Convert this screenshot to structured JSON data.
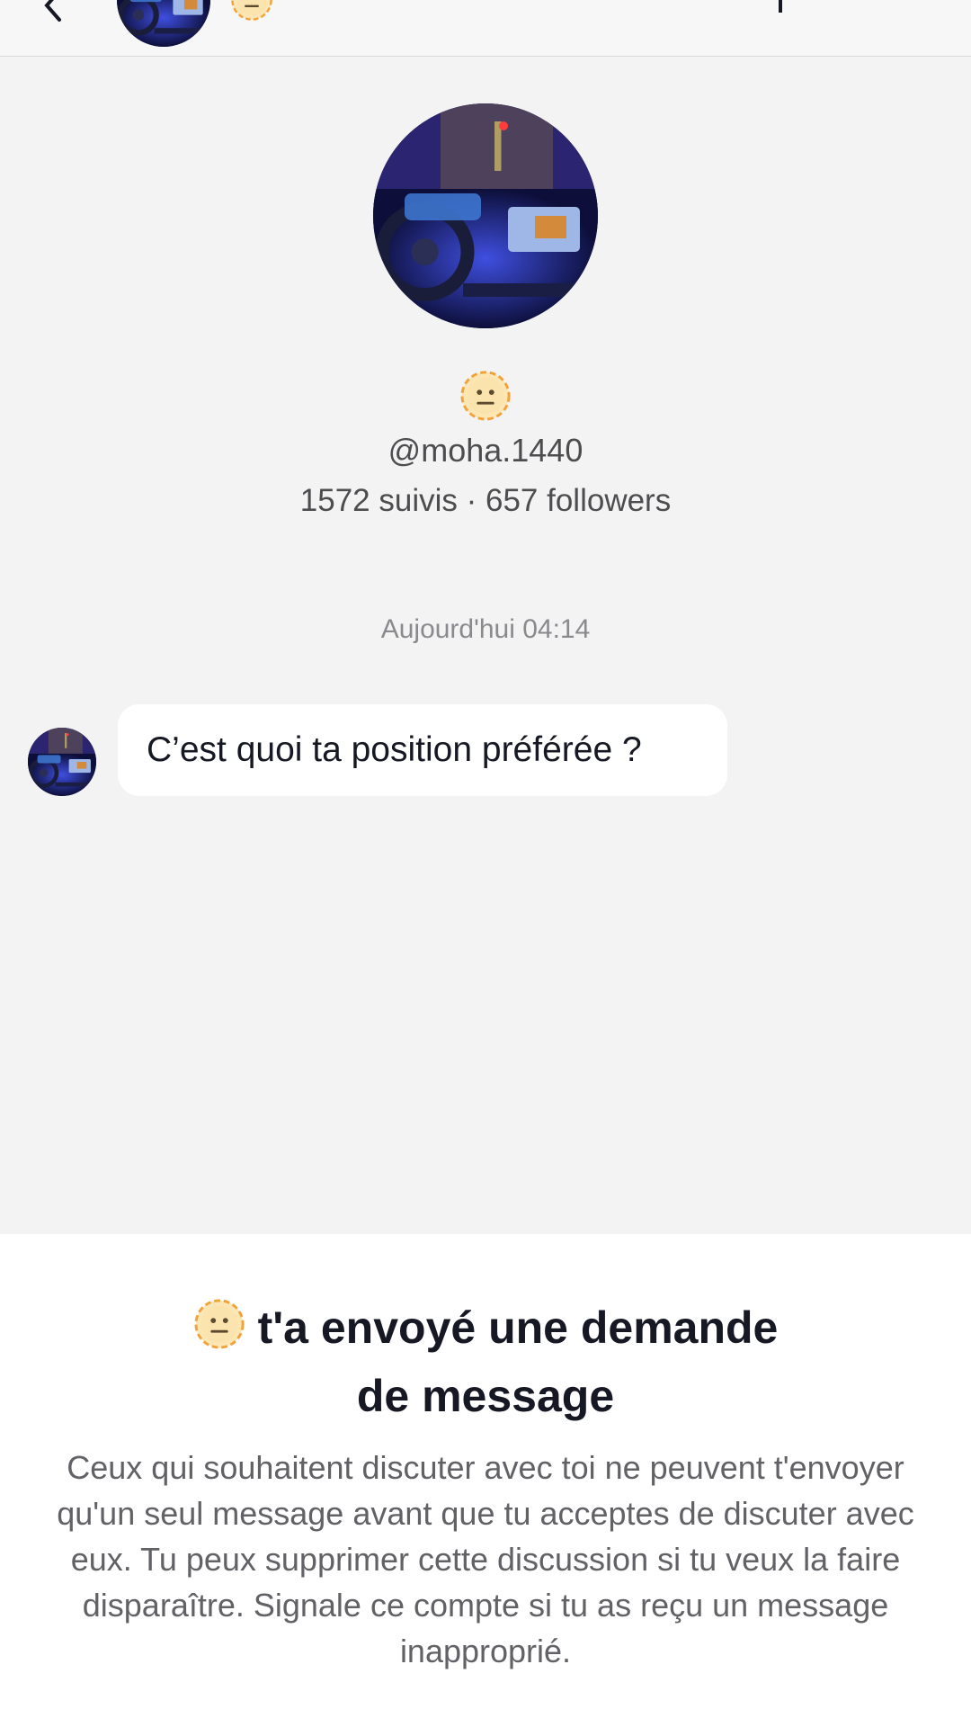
{
  "header": {
    "back_icon": "chevron-left-icon",
    "avatar_icon": "profile-photo",
    "status_icon": "neutral-face-emoji",
    "action_icon": "flag-icon"
  },
  "profile": {
    "avatar": "car-dashboard-photo",
    "emoji_icon": "neutral-face-emoji",
    "username": "@moha.1440",
    "stats": "1572 suivis · 657 followers"
  },
  "conversation": {
    "timestamp": "Aujourd'hui 04:14",
    "messages": [
      {
        "avatar": "car-dashboard-photo",
        "text": "C’est quoi ta position préférée ?"
      }
    ]
  },
  "request_panel": {
    "emoji_icon": "neutral-face-emoji",
    "title_line1": "t'a envoyé une demande",
    "title_line2": "de message",
    "body": "Ceux qui souhaitent discuter avec toi ne peuvent t'envoyer qu'un seul message avant que tu acceptes de discuter avec eux. Tu peux supprimer cette discussion si tu veux la faire disparaître. Signale ce compte si tu as reçu un message inapproprié."
  },
  "colors": {
    "chat_background": "#f3f3f4",
    "bubble": "#ffffff",
    "emoji_yellow": "#f7c64c",
    "emoji_ring": "#f2a23a"
  }
}
